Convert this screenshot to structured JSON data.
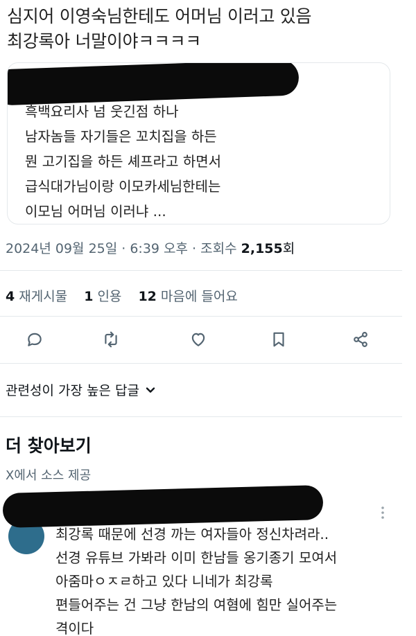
{
  "tweet": {
    "lines": [
      "심지어 이영숙님한테도 어머님 이러고 있음",
      "최강록아 너말이야ㅋㅋㅋㅋ"
    ]
  },
  "quote": {
    "author_redacted": true,
    "lines": [
      "흑백요리사 넘 웃긴점 하나",
      "남자놈들 자기들은 꼬치집을 하든",
      "뭔 고기집을 하든 셰프라고 하면서",
      "급식대가님이랑 이모카세님한테는",
      "이모님 어머님 이러냐 ..."
    ]
  },
  "meta": {
    "datetime": "2024년 09월 25일 · 6:39 오후 · 조회수 ",
    "views_count": "2,155",
    "views_unit": "회"
  },
  "stats": {
    "retweets_num": "4",
    "retweets_label": "재게시물",
    "quotes_num": "1",
    "quotes_label": "인용",
    "likes_num": "12",
    "likes_label": "마음에 들어요"
  },
  "actions": {
    "icons": [
      "reply-icon",
      "retweet-icon",
      "like-icon",
      "bookmark-icon",
      "share-icon"
    ]
  },
  "sort": {
    "label": "관련성이 가장 높은 답글"
  },
  "explore": {
    "title": "더 찾아보기",
    "subtitle": "X에서 소스 제공"
  },
  "reply": {
    "author_redacted": true,
    "lines": [
      "최강록 때문에 선경 까는 여자들아 정신차려라..",
      "선경 유튜브 가봐라 이미 한남들 옹기종기 모여서",
      "아줌마ㅇㅈㄹ하고 있다 니네가 최강록",
      "편들어주는 건 그냥 한남의 여혐에 힘만 실어주는",
      "격이다"
    ]
  },
  "colors": {
    "text": "#0f1419",
    "secondary": "#536471",
    "border": "#e4e8eb",
    "avatar": "#2e6d8c"
  }
}
